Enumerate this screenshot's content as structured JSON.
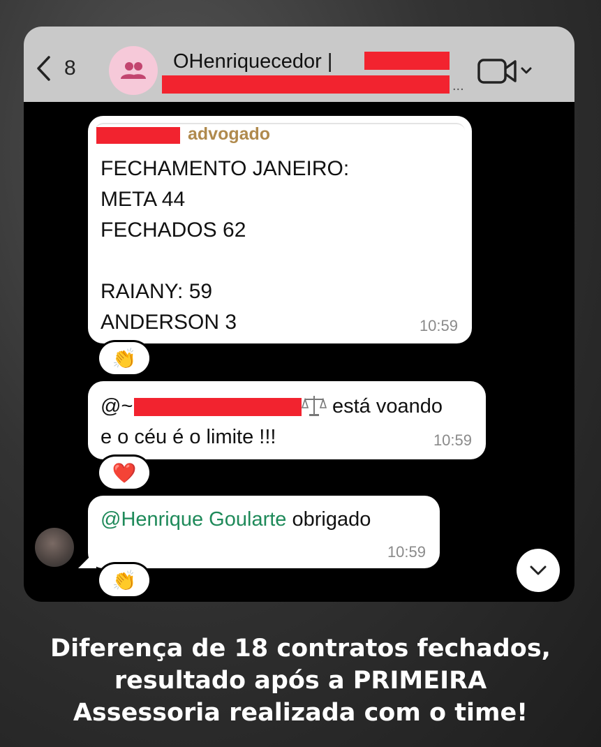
{
  "header": {
    "back_count": "8",
    "group_name": "OHenriquecedor |",
    "subtitle_ellipsis": "..."
  },
  "messages": [
    {
      "author_suffix": "advogado",
      "lines": [
        "FECHAMENTO JANEIRO:",
        "META 44",
        "FECHADOS 62",
        "",
        "RAIANY: 59",
        "ANDERSON 3"
      ],
      "time": "10:59",
      "reaction": "👏"
    },
    {
      "line1_prefix": "@~",
      "line1_suffix": "está voando",
      "line2": "e o céu é o limite !!!",
      "time": "10:59",
      "reaction": "❤️"
    },
    {
      "mention": "@Henrique Goularte",
      "text": " obrigado",
      "time": "10:59",
      "reaction": "👏"
    }
  ],
  "caption": {
    "line1": "Diferença de 18 contratos fechados,",
    "line2": "resultado após a PRIMEIRA",
    "line3": "Assessoria realizada com o time!"
  },
  "icons": {
    "back": "chevron-left-icon",
    "group": "group-icon",
    "video": "video-camera-icon",
    "scroll": "chevron-down-icon"
  },
  "colors": {
    "header_bg": "#c9c9c9",
    "avatar_bg": "#f6c9d9",
    "author_gold": "#b08a4d",
    "mention_green": "#1f8a5a",
    "redaction_red": "#f2232f"
  }
}
